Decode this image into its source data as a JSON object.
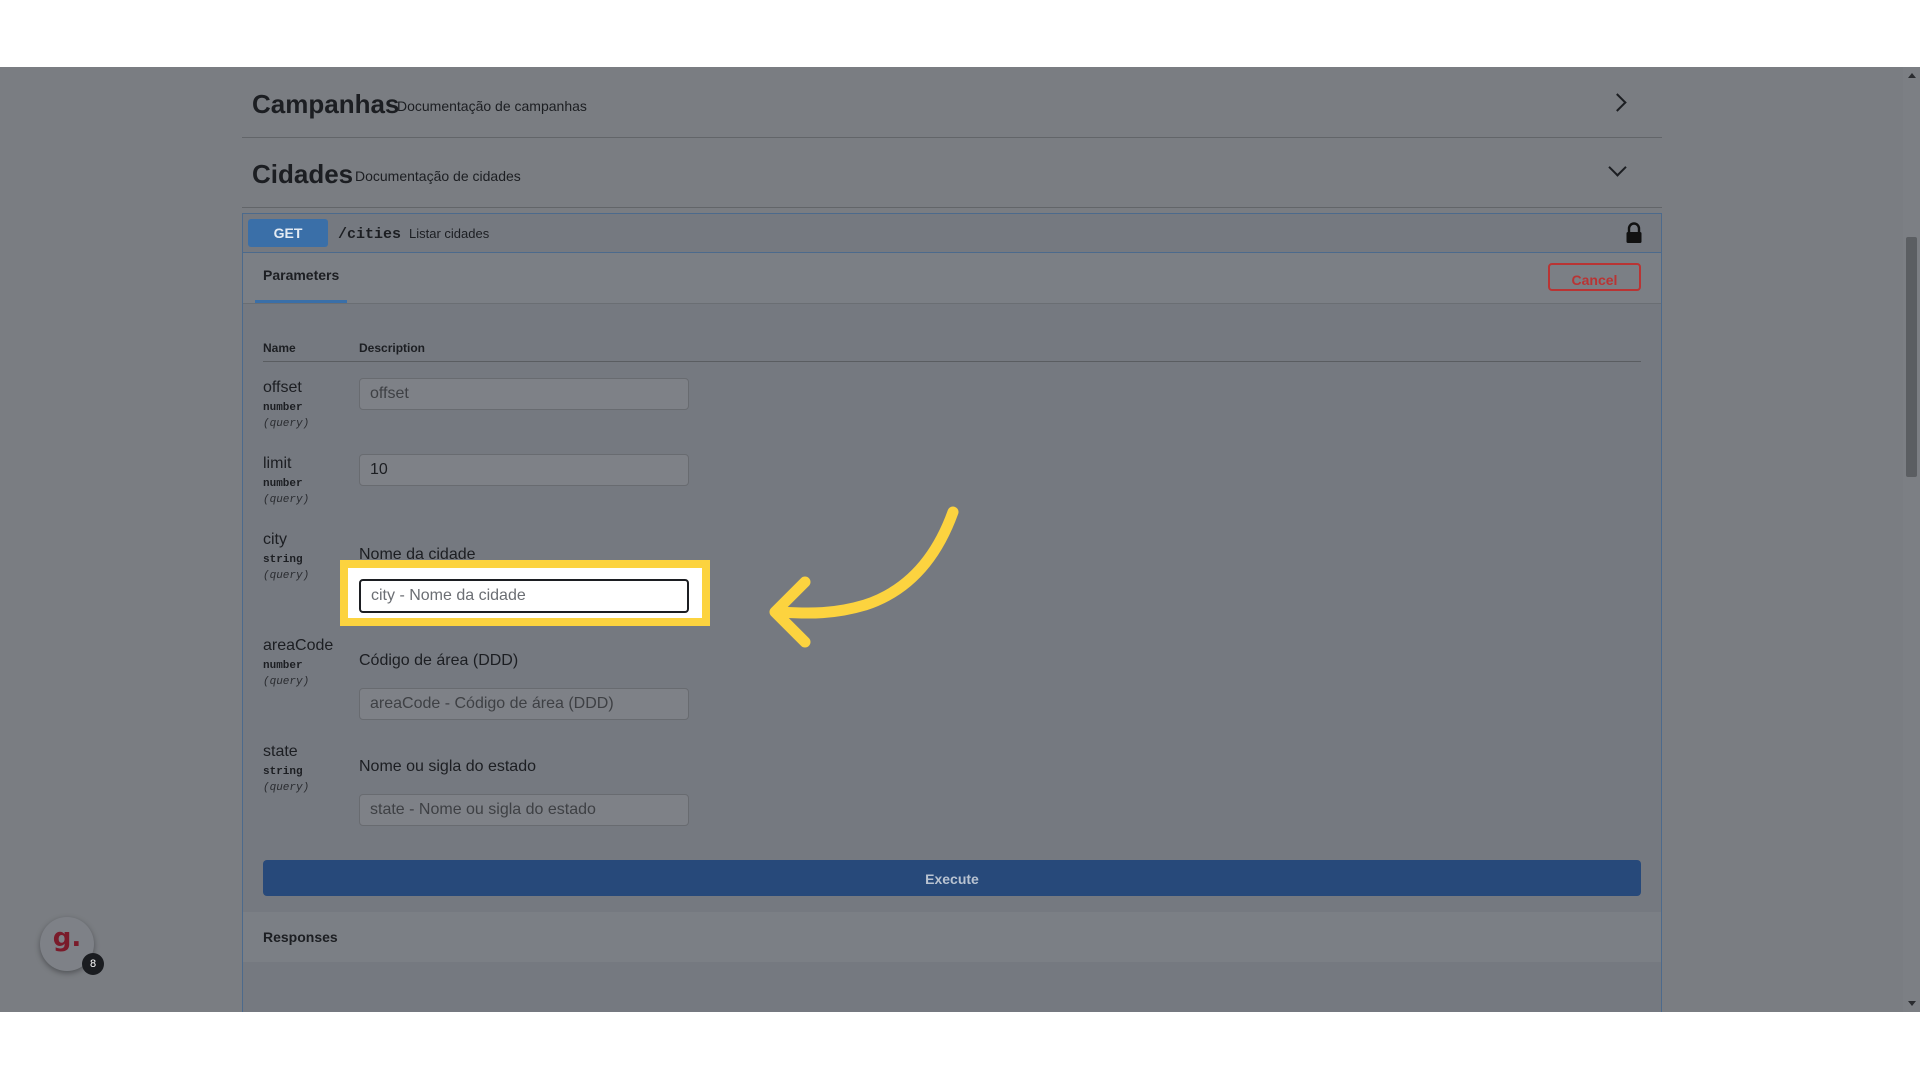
{
  "sections": [
    {
      "title": "Campanhas",
      "description": "Documentação de campanhas",
      "expanded": false
    },
    {
      "title": "Cidades",
      "description": "Documentação de cidades",
      "expanded": true
    }
  ],
  "operation": {
    "method": "GET",
    "path": "/cities",
    "description": "Listar cidades",
    "tab": "Parameters",
    "cancel_label": "Cancel",
    "col_name": "Name",
    "col_description": "Description",
    "params": [
      {
        "name": "offset",
        "type": "number",
        "in": "(query)",
        "description": "",
        "value": "",
        "placeholder": "offset"
      },
      {
        "name": "limit",
        "type": "number",
        "in": "(query)",
        "description": "",
        "value": "10",
        "placeholder": ""
      },
      {
        "name": "city",
        "type": "string",
        "in": "(query)",
        "description": "Nome da cidade",
        "value": "",
        "placeholder": "city - Nome da cidade"
      },
      {
        "name": "areaCode",
        "type": "number",
        "in": "(query)",
        "description": "Código de área (DDD)",
        "value": "",
        "placeholder": "areaCode - Código de área (DDD)"
      },
      {
        "name": "state",
        "type": "string",
        "in": "(query)",
        "description": "Nome ou sigla do estado",
        "value": "",
        "placeholder": "state - Nome ou sigla do estado"
      }
    ],
    "execute_label": "Execute",
    "responses_label": "Responses"
  },
  "widget": {
    "logo": "g.",
    "badge": "8"
  },
  "colors": {
    "highlight": "#fcd33f",
    "method_get": "#3a6fa8",
    "cancel": "#b93434",
    "execute": "#27497a"
  }
}
